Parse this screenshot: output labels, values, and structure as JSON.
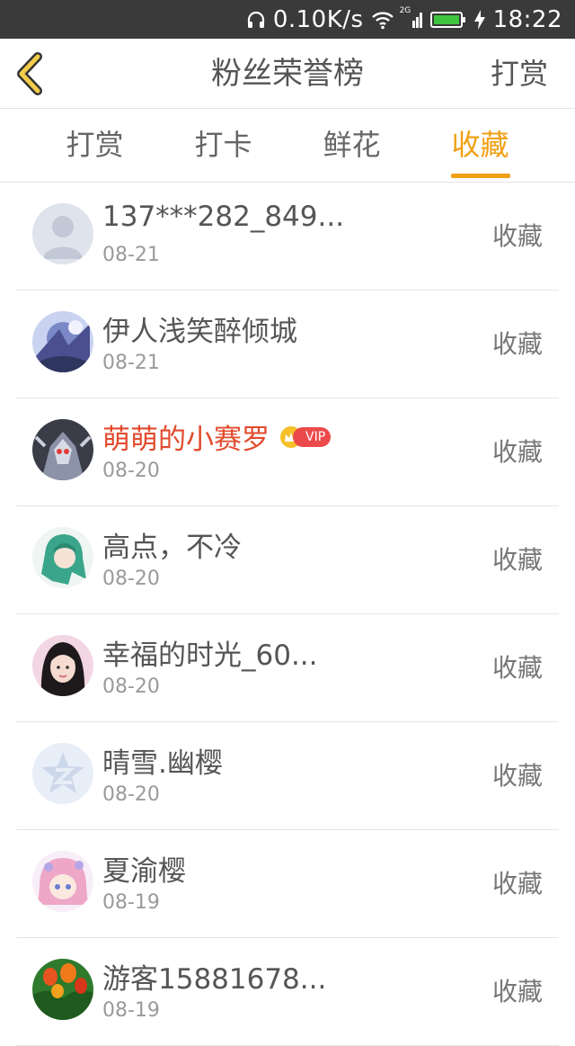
{
  "status_bar": {
    "speed": "0.10K/s",
    "network": "2G",
    "time": "18:22"
  },
  "header": {
    "title": "粉丝荣誉榜",
    "action": "打赏"
  },
  "tabs": [
    {
      "label": "打赏",
      "active": false
    },
    {
      "label": "打卡",
      "active": false
    },
    {
      "label": "鲜花",
      "active": false
    },
    {
      "label": "收藏",
      "active": true
    }
  ],
  "accent_color": "#f0a014",
  "vip_name_color": "#e24a2c",
  "rows": [
    {
      "name": "137***282_849...",
      "date": "08-21",
      "action": "收藏",
      "vip": false
    },
    {
      "name": "伊人浅笑醉倾城",
      "date": "08-21",
      "action": "收藏",
      "vip": false
    },
    {
      "name": "萌萌的小赛罗",
      "date": "08-20",
      "action": "收藏",
      "vip": true,
      "badge": "VIP"
    },
    {
      "name": "高点，不冷",
      "date": "08-20",
      "action": "收藏",
      "vip": false
    },
    {
      "name": "幸福的时光_60...",
      "date": "08-20",
      "action": "收藏",
      "vip": false
    },
    {
      "name": "晴雪.幽樱",
      "date": "08-20",
      "action": "收藏",
      "vip": false
    },
    {
      "name": "夏渝樱",
      "date": "08-19",
      "action": "收藏",
      "vip": false
    },
    {
      "name": "游客15881678...",
      "date": "08-19",
      "action": "收藏",
      "vip": false
    }
  ]
}
